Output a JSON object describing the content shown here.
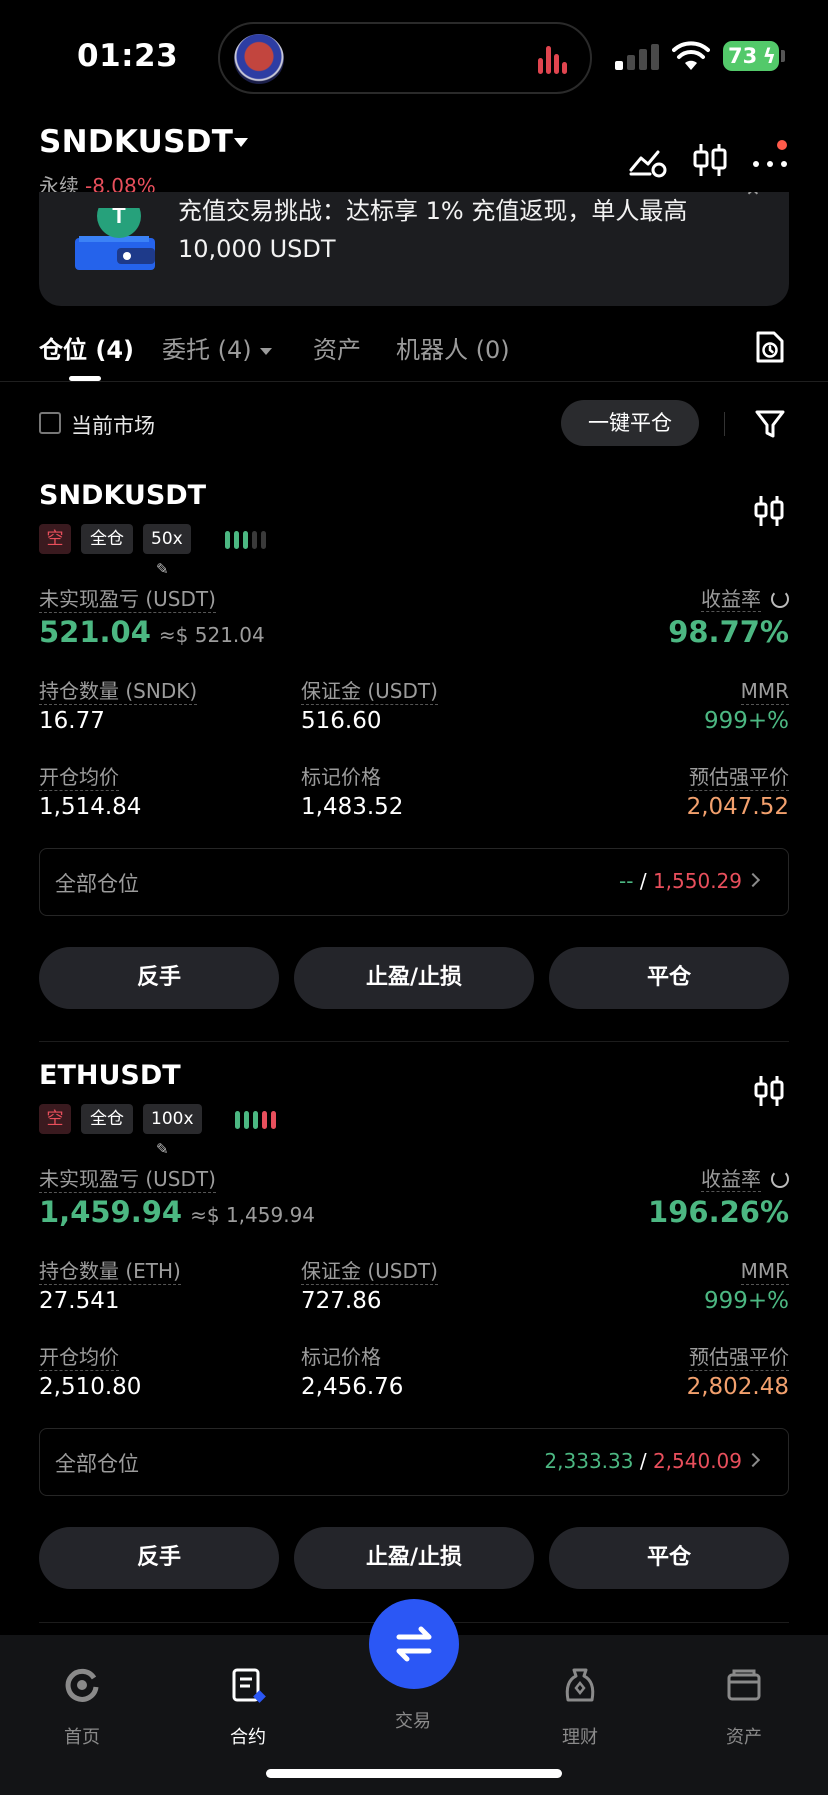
{
  "status_bar": {
    "time": "01:23",
    "battery": "73",
    "icons": [
      "app-logo-icon",
      "audio-bars-icon",
      "signal-icon",
      "wifi-icon",
      "battery-icon"
    ]
  },
  "header": {
    "symbol": "SNDKUSDT",
    "contract_type": "永续",
    "change": "-8.08%",
    "icons": [
      "chart-settings-icon",
      "candlestick-icon",
      "more-icon"
    ]
  },
  "banner": {
    "text": "充值交易挑战：达标享 1% 充值返现，单人最高 10,000 USDT",
    "close_icon": "close-icon"
  },
  "tabs": [
    {
      "label": "仓位 (4)",
      "active": true
    },
    {
      "label": "委托 (4)",
      "active": false
    },
    {
      "label": "资产",
      "active": false
    },
    {
      "label": "机器人 (0)",
      "active": false
    }
  ],
  "filter": {
    "current_market": "当前市场",
    "close_all": "一键平仓"
  },
  "labels": {
    "unrealized": "未实现盈亏 (USDT)",
    "roe": "收益率",
    "margin": "保证金 (USDT)",
    "mmr": "MMR",
    "entry": "开仓均价",
    "mark": "标记价格",
    "liq": "预估强平价",
    "all_pos": "全部仓位",
    "reverse": "反手",
    "tpsl": "止盈/止损",
    "close": "平仓",
    "side_short": "空",
    "margin_mode": "全仓"
  },
  "positions": [
    {
      "symbol": "SNDKUSDT",
      "leverage": "50x",
      "unrealized": "521.04",
      "unrealized_approx": "≈$ 521.04",
      "roe": "98.77%",
      "qty_label": "持仓数量 (SNDK)",
      "qty": "16.77",
      "margin": "516.60",
      "mmr": "999+%",
      "entry": "1,514.84",
      "mark": "1,483.52",
      "liq": "2,047.52",
      "tp": "--",
      "sl": "1,550.29",
      "adl_level": 3
    },
    {
      "symbol": "ETHUSDT",
      "leverage": "100x",
      "unrealized": "1,459.94",
      "unrealized_approx": "≈$ 1,459.94",
      "roe": "196.26%",
      "qty_label": "持仓数量 (ETH)",
      "qty": "27.541",
      "margin": "727.86",
      "mmr": "999+%",
      "entry": "2,510.80",
      "mark": "2,456.76",
      "liq": "2,802.48",
      "tp": "2,333.33",
      "sl": "2,540.09",
      "adl_level": 5
    }
  ],
  "bottom_nav": [
    {
      "label": "首页",
      "icon": "home-icon",
      "active": false
    },
    {
      "label": "合约",
      "icon": "contract-icon",
      "active": true
    },
    {
      "label": "交易",
      "icon": "swap-icon",
      "active": false
    },
    {
      "label": "理财",
      "icon": "finance-icon",
      "active": false
    },
    {
      "label": "资产",
      "icon": "wallet-icon",
      "active": false
    }
  ],
  "colors": {
    "green": "#4cb782",
    "red": "#e84f5c",
    "orange": "#f2a06d",
    "accent_blue": "#2b57f5"
  }
}
